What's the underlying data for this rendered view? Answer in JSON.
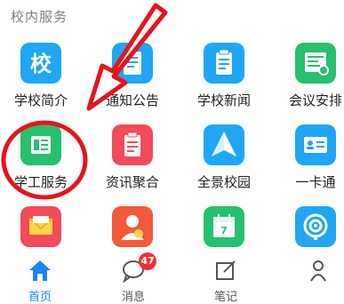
{
  "section": {
    "title": "校内服务"
  },
  "tiles": [
    {
      "label": "学校简介",
      "icon": "school-emblem-icon",
      "color": "#1fa6f5"
    },
    {
      "label": "通知公告",
      "icon": "notice-document-icon",
      "color": "#1fa6f5"
    },
    {
      "label": "学校新闻",
      "icon": "news-clipboard-icon",
      "color": "#1fa6f5"
    },
    {
      "label": "会议安排",
      "icon": "meeting-schedule-icon",
      "color": "#27c06e"
    },
    {
      "label": "学工服务",
      "icon": "student-affairs-icon",
      "color": "#27c06e"
    },
    {
      "label": "资讯聚合",
      "icon": "info-aggregate-icon",
      "color": "#f24b5a"
    },
    {
      "label": "全景校园",
      "icon": "panorama-campus-icon",
      "color": "#1fa6f5"
    },
    {
      "label": "一卡通",
      "icon": "campus-card-icon",
      "color": "#1fa6f5"
    },
    {
      "label": "",
      "icon": "mail-icon",
      "color": "#f24b5a"
    },
    {
      "label": "",
      "icon": "party-building-icon",
      "color": "#f25a3a"
    },
    {
      "label": "",
      "icon": "calendar-icon",
      "color": "#27c06e"
    },
    {
      "label": "",
      "icon": "podcast-icon",
      "color": "#1fa6f5"
    }
  ],
  "nav": {
    "items": [
      {
        "label": "首页",
        "icon": "home-icon",
        "active": true
      },
      {
        "label": "消息",
        "icon": "message-icon",
        "badge": "47"
      },
      {
        "label": "笔记",
        "icon": "note-icon"
      },
      {
        "label": "",
        "icon": "profile-icon"
      }
    ]
  },
  "colors": {
    "accent": "#1a84f0",
    "badge": "#f23030",
    "annotation": "#e8131b"
  }
}
